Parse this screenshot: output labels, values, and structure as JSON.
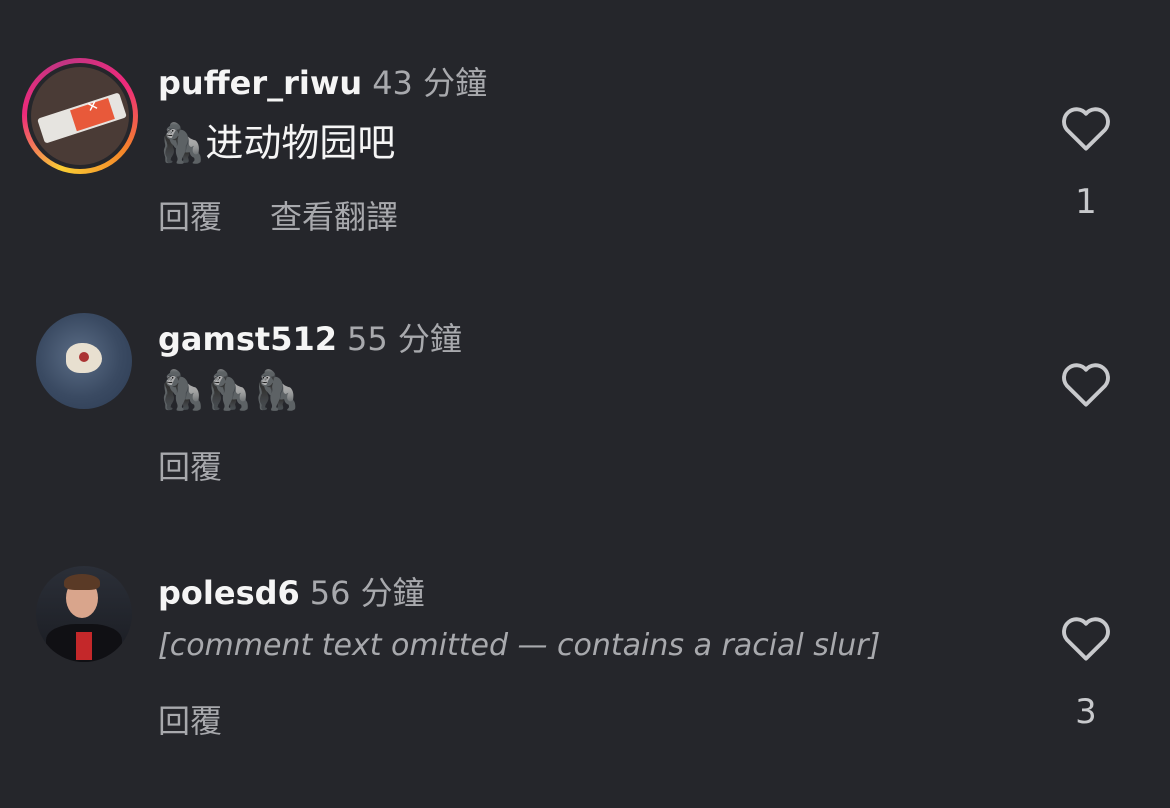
{
  "comments": [
    {
      "username": "puffer_riwu",
      "time": "43 分鐘",
      "text": "🦍进动物园吧",
      "actions": [
        "回覆",
        "查看翻譯"
      ],
      "likes": "1"
    },
    {
      "username": "gamst512",
      "time": "55 分鐘",
      "text": "🦍🦍🦍",
      "actions": [
        "回覆"
      ],
      "likes": ""
    },
    {
      "username": "polesd6",
      "time": "56 分鐘",
      "text": "[comment text omitted — contains a racial slur]",
      "actions": [
        "回覆"
      ],
      "likes": "3"
    }
  ],
  "icons": {
    "like": "heart-outline-icon"
  },
  "colors": {
    "background": "#25262b",
    "secondary_text": "#a8a9ad",
    "story_ring": "#ee2a7b"
  }
}
